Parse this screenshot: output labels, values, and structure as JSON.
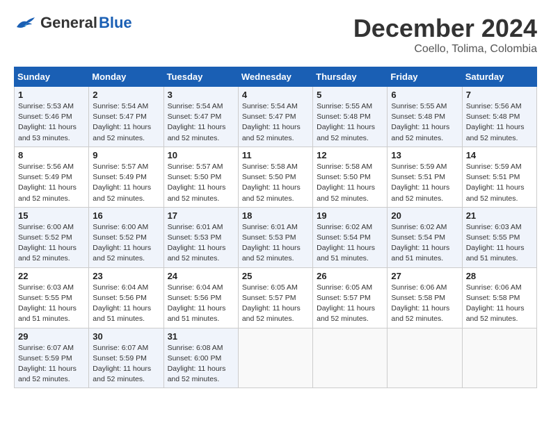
{
  "header": {
    "logo_general": "General",
    "logo_blue": "Blue",
    "month_title": "December 2024",
    "location": "Coello, Tolima, Colombia"
  },
  "weekdays": [
    "Sunday",
    "Monday",
    "Tuesday",
    "Wednesday",
    "Thursday",
    "Friday",
    "Saturday"
  ],
  "weeks": [
    [
      {
        "day": "1",
        "info": "Sunrise: 5:53 AM\nSunset: 5:46 PM\nDaylight: 11 hours\nand 53 minutes."
      },
      {
        "day": "2",
        "info": "Sunrise: 5:54 AM\nSunset: 5:47 PM\nDaylight: 11 hours\nand 52 minutes."
      },
      {
        "day": "3",
        "info": "Sunrise: 5:54 AM\nSunset: 5:47 PM\nDaylight: 11 hours\nand 52 minutes."
      },
      {
        "day": "4",
        "info": "Sunrise: 5:54 AM\nSunset: 5:47 PM\nDaylight: 11 hours\nand 52 minutes."
      },
      {
        "day": "5",
        "info": "Sunrise: 5:55 AM\nSunset: 5:48 PM\nDaylight: 11 hours\nand 52 minutes."
      },
      {
        "day": "6",
        "info": "Sunrise: 5:55 AM\nSunset: 5:48 PM\nDaylight: 11 hours\nand 52 minutes."
      },
      {
        "day": "7",
        "info": "Sunrise: 5:56 AM\nSunset: 5:48 PM\nDaylight: 11 hours\nand 52 minutes."
      }
    ],
    [
      {
        "day": "8",
        "info": "Sunrise: 5:56 AM\nSunset: 5:49 PM\nDaylight: 11 hours\nand 52 minutes."
      },
      {
        "day": "9",
        "info": "Sunrise: 5:57 AM\nSunset: 5:49 PM\nDaylight: 11 hours\nand 52 minutes."
      },
      {
        "day": "10",
        "info": "Sunrise: 5:57 AM\nSunset: 5:50 PM\nDaylight: 11 hours\nand 52 minutes."
      },
      {
        "day": "11",
        "info": "Sunrise: 5:58 AM\nSunset: 5:50 PM\nDaylight: 11 hours\nand 52 minutes."
      },
      {
        "day": "12",
        "info": "Sunrise: 5:58 AM\nSunset: 5:50 PM\nDaylight: 11 hours\nand 52 minutes."
      },
      {
        "day": "13",
        "info": "Sunrise: 5:59 AM\nSunset: 5:51 PM\nDaylight: 11 hours\nand 52 minutes."
      },
      {
        "day": "14",
        "info": "Sunrise: 5:59 AM\nSunset: 5:51 PM\nDaylight: 11 hours\nand 52 minutes."
      }
    ],
    [
      {
        "day": "15",
        "info": "Sunrise: 6:00 AM\nSunset: 5:52 PM\nDaylight: 11 hours\nand 52 minutes."
      },
      {
        "day": "16",
        "info": "Sunrise: 6:00 AM\nSunset: 5:52 PM\nDaylight: 11 hours\nand 52 minutes."
      },
      {
        "day": "17",
        "info": "Sunrise: 6:01 AM\nSunset: 5:53 PM\nDaylight: 11 hours\nand 52 minutes."
      },
      {
        "day": "18",
        "info": "Sunrise: 6:01 AM\nSunset: 5:53 PM\nDaylight: 11 hours\nand 52 minutes."
      },
      {
        "day": "19",
        "info": "Sunrise: 6:02 AM\nSunset: 5:54 PM\nDaylight: 11 hours\nand 51 minutes."
      },
      {
        "day": "20",
        "info": "Sunrise: 6:02 AM\nSunset: 5:54 PM\nDaylight: 11 hours\nand 51 minutes."
      },
      {
        "day": "21",
        "info": "Sunrise: 6:03 AM\nSunset: 5:55 PM\nDaylight: 11 hours\nand 51 minutes."
      }
    ],
    [
      {
        "day": "22",
        "info": "Sunrise: 6:03 AM\nSunset: 5:55 PM\nDaylight: 11 hours\nand 51 minutes."
      },
      {
        "day": "23",
        "info": "Sunrise: 6:04 AM\nSunset: 5:56 PM\nDaylight: 11 hours\nand 51 minutes."
      },
      {
        "day": "24",
        "info": "Sunrise: 6:04 AM\nSunset: 5:56 PM\nDaylight: 11 hours\nand 51 minutes."
      },
      {
        "day": "25",
        "info": "Sunrise: 6:05 AM\nSunset: 5:57 PM\nDaylight: 11 hours\nand 52 minutes."
      },
      {
        "day": "26",
        "info": "Sunrise: 6:05 AM\nSunset: 5:57 PM\nDaylight: 11 hours\nand 52 minutes."
      },
      {
        "day": "27",
        "info": "Sunrise: 6:06 AM\nSunset: 5:58 PM\nDaylight: 11 hours\nand 52 minutes."
      },
      {
        "day": "28",
        "info": "Sunrise: 6:06 AM\nSunset: 5:58 PM\nDaylight: 11 hours\nand 52 minutes."
      }
    ],
    [
      {
        "day": "29",
        "info": "Sunrise: 6:07 AM\nSunset: 5:59 PM\nDaylight: 11 hours\nand 52 minutes."
      },
      {
        "day": "30",
        "info": "Sunrise: 6:07 AM\nSunset: 5:59 PM\nDaylight: 11 hours\nand 52 minutes."
      },
      {
        "day": "31",
        "info": "Sunrise: 6:08 AM\nSunset: 6:00 PM\nDaylight: 11 hours\nand 52 minutes."
      },
      {
        "day": "",
        "info": ""
      },
      {
        "day": "",
        "info": ""
      },
      {
        "day": "",
        "info": ""
      },
      {
        "day": "",
        "info": ""
      }
    ]
  ]
}
